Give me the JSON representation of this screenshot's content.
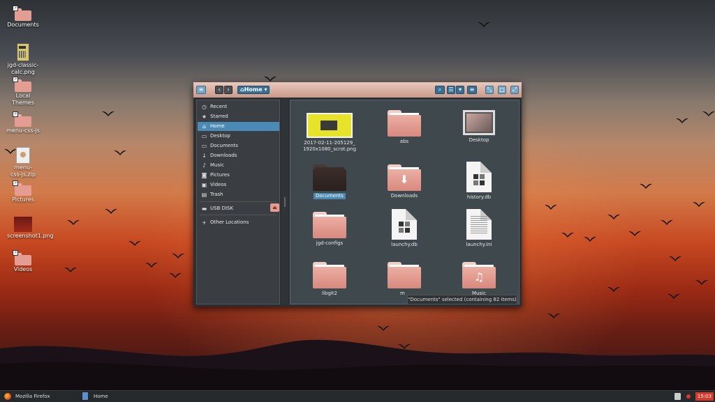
{
  "desktop": {
    "icons": [
      {
        "label": "Documents",
        "kind": "folder"
      },
      {
        "label": "jgd-classic-calc.png",
        "kind": "image"
      },
      {
        "label": "Local Themes",
        "kind": "folder"
      },
      {
        "label": "menu-css-js",
        "kind": "folder"
      },
      {
        "label": "menu-css-js.zip",
        "kind": "archive"
      },
      {
        "label": "Pictures",
        "kind": "folder"
      },
      {
        "label": "screenshot1.png",
        "kind": "image"
      },
      {
        "label": "Videos",
        "kind": "folder"
      }
    ]
  },
  "file_manager": {
    "toolbar": {
      "location": "Home",
      "icons": [
        "app-menu-icon",
        "back-icon",
        "forward-icon",
        "home-icon",
        "search-icon",
        "list-view-icon",
        "view-options-icon",
        "menu-icon",
        "maximize-icon",
        "restore-icon",
        "close-icon"
      ]
    },
    "sidebar": {
      "items": [
        {
          "label": "Recent",
          "icon": "clock-icon",
          "glyph": "◷"
        },
        {
          "label": "Starred",
          "icon": "star-icon",
          "glyph": "★"
        },
        {
          "label": "Home",
          "icon": "home-icon",
          "glyph": "⌂",
          "active": true
        },
        {
          "label": "Desktop",
          "icon": "desktop-folder-icon",
          "glyph": "▭"
        },
        {
          "label": "Documents",
          "icon": "documents-folder-icon",
          "glyph": "▭"
        },
        {
          "label": "Downloads",
          "icon": "download-icon",
          "glyph": "↓"
        },
        {
          "label": "Music",
          "icon": "music-icon",
          "glyph": "♪"
        },
        {
          "label": "Pictures",
          "icon": "camera-icon",
          "glyph": "◙"
        },
        {
          "label": "Videos",
          "icon": "video-icon",
          "glyph": "▣"
        },
        {
          "label": "Trash",
          "icon": "trash-icon",
          "glyph": "▤"
        },
        {
          "label": "USB DISK",
          "icon": "drive-icon",
          "glyph": "▬",
          "eject": true
        },
        {
          "label": "Other Locations",
          "icon": "plus-icon",
          "glyph": "+"
        }
      ],
      "eject_glyph": "⏏"
    },
    "files": [
      {
        "name": "2017-02-11-205129_1920x1080_scrot.png",
        "line1": "2017-02-11-205129_",
        "line2": "1920x1080_scrot.png",
        "kind": "image-thumb"
      },
      {
        "name": "abs",
        "kind": "folder"
      },
      {
        "name": "Desktop",
        "kind": "desktop-thumb"
      },
      {
        "name": "Documents",
        "kind": "folder-dark",
        "selected": true
      },
      {
        "name": "Downloads",
        "kind": "folder-download"
      },
      {
        "name": "history.db",
        "kind": "db-file"
      },
      {
        "name": "jgd-configs",
        "kind": "folder"
      },
      {
        "name": "launchy.db",
        "kind": "db-file"
      },
      {
        "name": "launchy.ini",
        "kind": "text-file"
      },
      {
        "name": "libgit2",
        "kind": "folder"
      },
      {
        "name": "m",
        "kind": "folder"
      },
      {
        "name": "Music",
        "kind": "folder-music"
      }
    ],
    "glyphs": {
      "download": "⬇",
      "music": "♫"
    },
    "status": "\"Documents\" selected (containing 82 items)"
  },
  "taskbar": {
    "items": [
      {
        "label": "Mozilla Firefox",
        "icon": "firefox-icon"
      },
      {
        "label": "Home",
        "icon": "file-manager-icon"
      }
    ],
    "clock": "15:03"
  },
  "colors": {
    "accent": "#4b8ab4",
    "folder": "#e39d92",
    "clock_bg": "#d73a2a"
  }
}
